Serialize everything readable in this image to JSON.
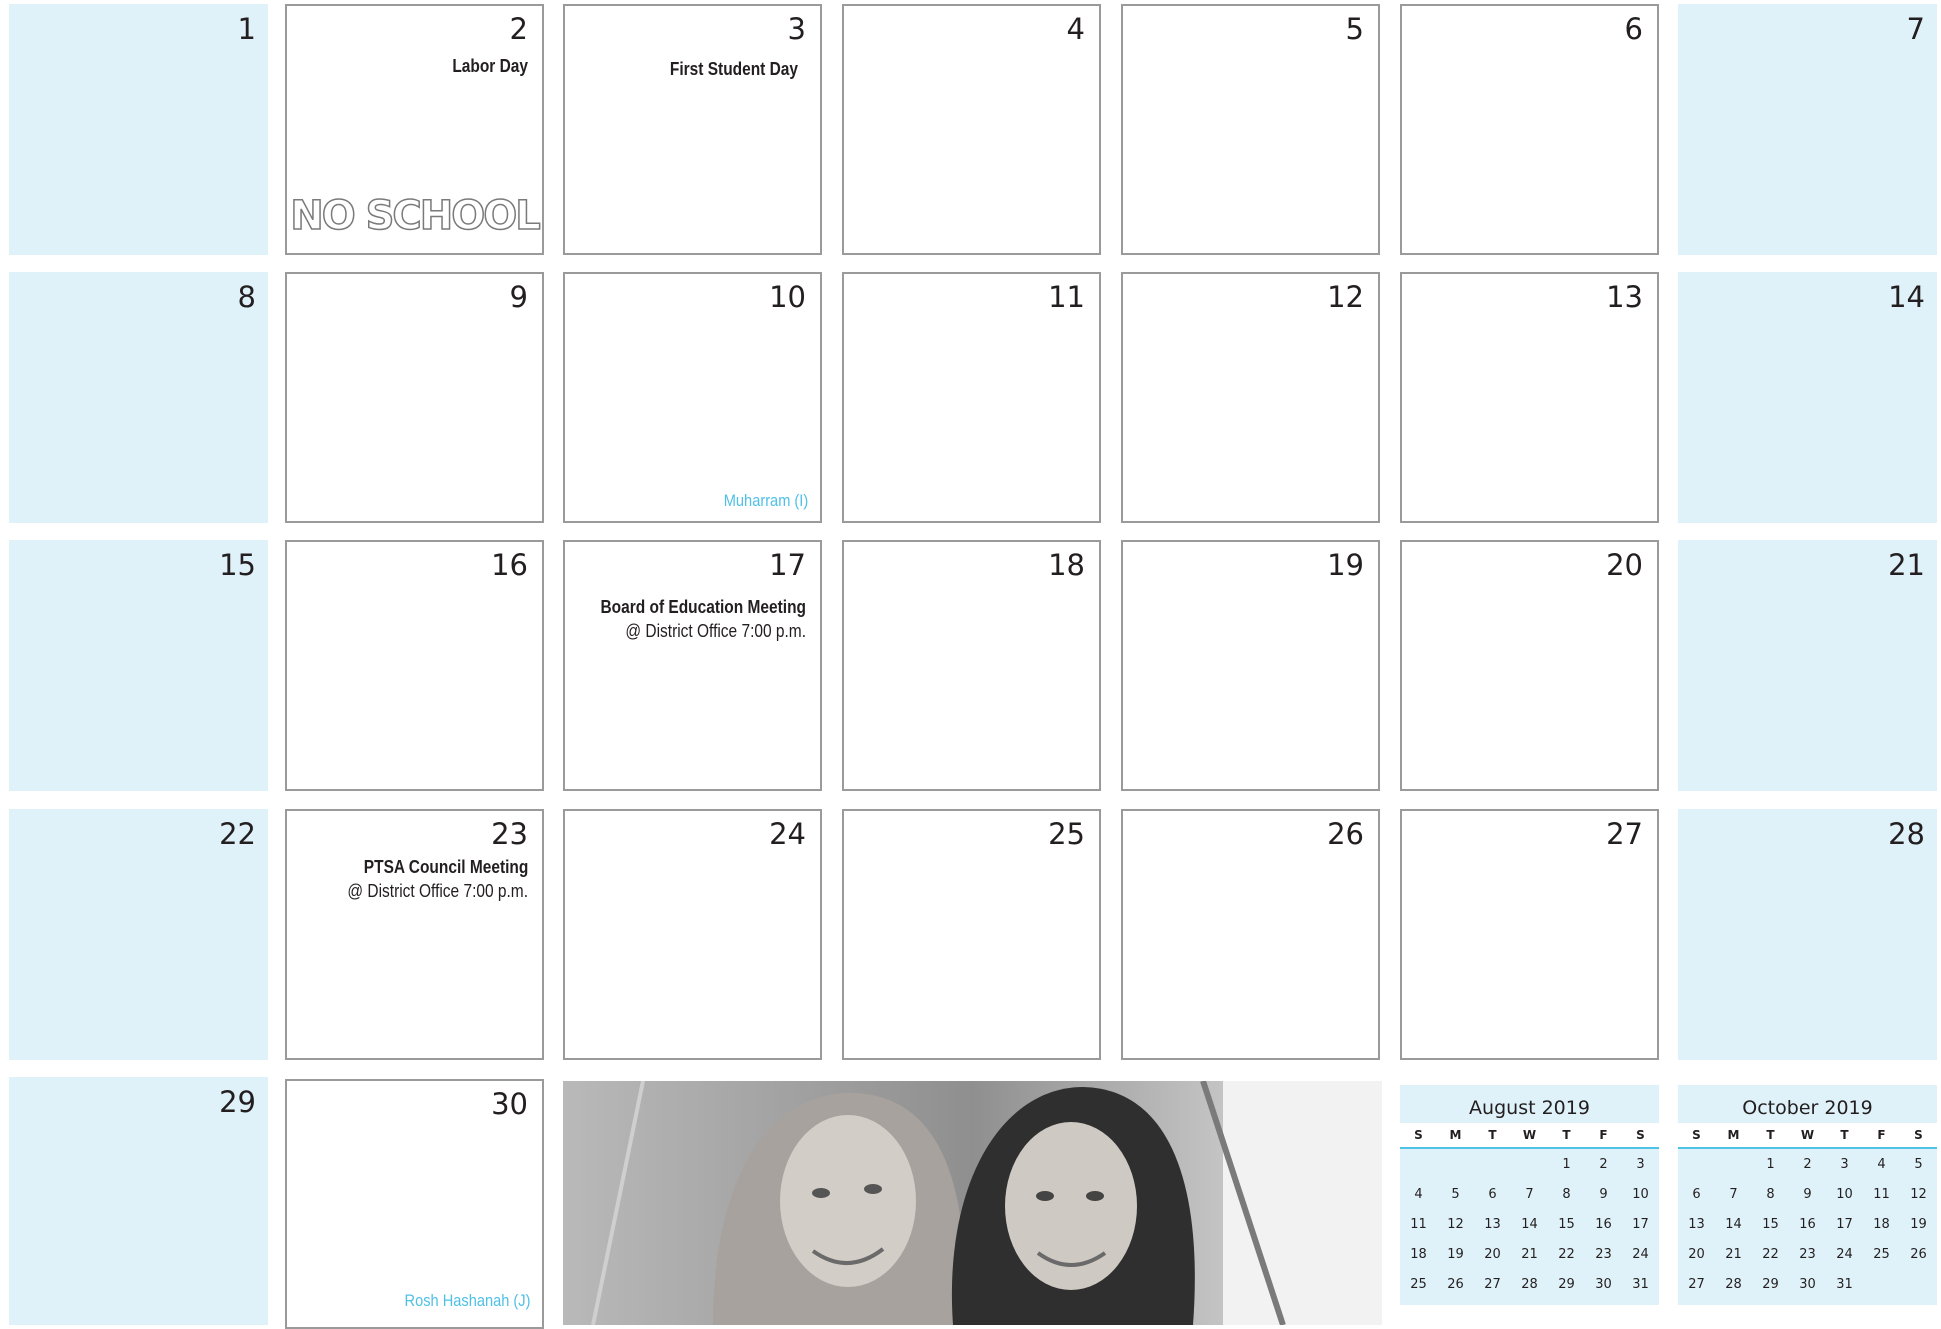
{
  "weeks": [
    [
      "1",
      "2",
      "3",
      "4",
      "5",
      "6",
      "7"
    ],
    [
      "8",
      "9",
      "10",
      "11",
      "12",
      "13",
      "14"
    ],
    [
      "15",
      "16",
      "17",
      "18",
      "19",
      "20",
      "21"
    ],
    [
      "22",
      "23",
      "24",
      "25",
      "26",
      "27",
      "28"
    ],
    [
      "29",
      "30"
    ]
  ],
  "events": {
    "labor_day": "Labor Day",
    "no_school": "NO SCHOOL",
    "first_student_day": "First Student Day",
    "muharram": "Muharram (I)",
    "board_meeting_title": "Board of Education Meeting",
    "board_meeting_detail": "@ District Office  7:00 p.m.",
    "ptsa_title": "PTSA Council Meeting",
    "ptsa_detail": "@ District Office  7:00 p.m.",
    "rosh_hashanah": "Rosh Hashanah (J)"
  },
  "mini_calendars": [
    {
      "title": "August 2019",
      "headers": [
        "S",
        "M",
        "T",
        "W",
        "T",
        "F",
        "S"
      ],
      "rows": [
        [
          "",
          "",
          "",
          "",
          "1",
          "2",
          "3"
        ],
        [
          "4",
          "5",
          "6",
          "7",
          "8",
          "9",
          "10"
        ],
        [
          "11",
          "12",
          "13",
          "14",
          "15",
          "16",
          "17"
        ],
        [
          "18",
          "19",
          "20",
          "21",
          "22",
          "23",
          "24"
        ],
        [
          "25",
          "26",
          "27",
          "28",
          "29",
          "30",
          "31"
        ]
      ]
    },
    {
      "title": "October 2019",
      "headers": [
        "S",
        "M",
        "T",
        "W",
        "T",
        "F",
        "S"
      ],
      "rows": [
        [
          "",
          "",
          "1",
          "2",
          "3",
          "4",
          "5"
        ],
        [
          "6",
          "7",
          "8",
          "9",
          "10",
          "11",
          "12"
        ],
        [
          "13",
          "14",
          "15",
          "16",
          "17",
          "18",
          "19"
        ],
        [
          "20",
          "21",
          "22",
          "23",
          "24",
          "25",
          "26"
        ],
        [
          "27",
          "28",
          "29",
          "30",
          "31",
          "",
          ""
        ]
      ]
    }
  ],
  "colors": {
    "weekend_fill": "#e0f2f9",
    "holiday_text": "#4fc0e6",
    "cell_border": "#9a9a9a",
    "text": "#231f20"
  },
  "photo_icon": "photo-two-students"
}
